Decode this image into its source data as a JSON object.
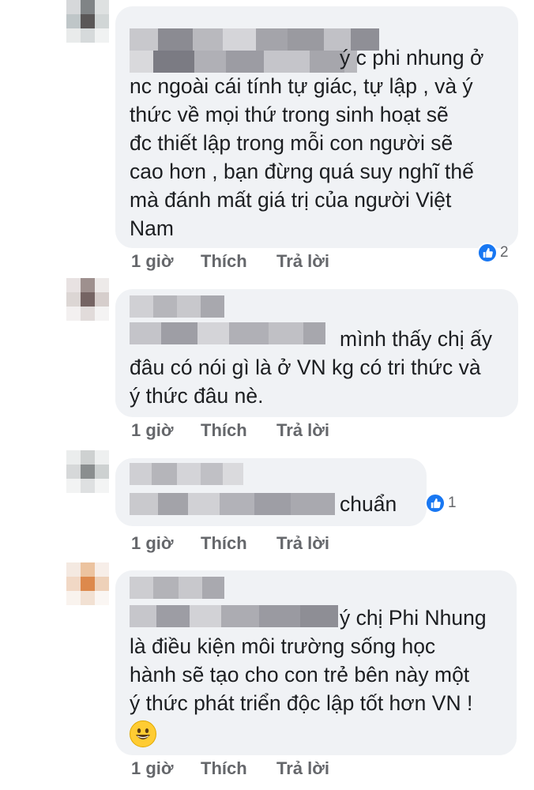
{
  "comments": [
    {
      "text_lines": [
        "ý c phi nhung ở",
        "nc ngoài cái tính tự giác, tự lập , và ý",
        "thức về mọi thứ trong sinh hoạt sẽ",
        "đc thiết lập trong mỗi con người sẽ",
        "cao hơn , bạn đừng quá suy nghĩ thế",
        "mà đánh mất giá trị của người Việt",
        "Nam"
      ],
      "time": "1 giờ",
      "like_label": "Thích",
      "reply_label": "Trả lời",
      "reaction_count": "2",
      "reaction_icon": "thumbs-up-icon"
    },
    {
      "text_lines": [
        "mình thấy chị ấy",
        "đâu có nói gì là ở VN kg có tri thức và",
        "ý thức đâu nè."
      ],
      "time": "1 giờ",
      "like_label": "Thích",
      "reply_label": "Trả lời"
    },
    {
      "text_lines": [
        "chuẩn"
      ],
      "time": "1 giờ",
      "like_label": "Thích",
      "reply_label": "Trả lời",
      "reaction_count": "1",
      "reaction_icon": "thumbs-up-icon"
    },
    {
      "text_lines": [
        "ý chị Phi Nhung",
        "là điều kiện môi trường sống học",
        "hành sẽ tạo cho con trẻ bên này một",
        "ý thức phát triển độc lập tốt hơn VN !"
      ],
      "emoji": "grinning-face-emoji",
      "time": "1 giờ",
      "like_label": "Thích",
      "reply_label": "Trả lời"
    }
  ],
  "colors": {
    "bubble": "#f0f2f5",
    "text": "#1c1e21",
    "meta": "#65676b",
    "like_blue": "#1877f2"
  }
}
